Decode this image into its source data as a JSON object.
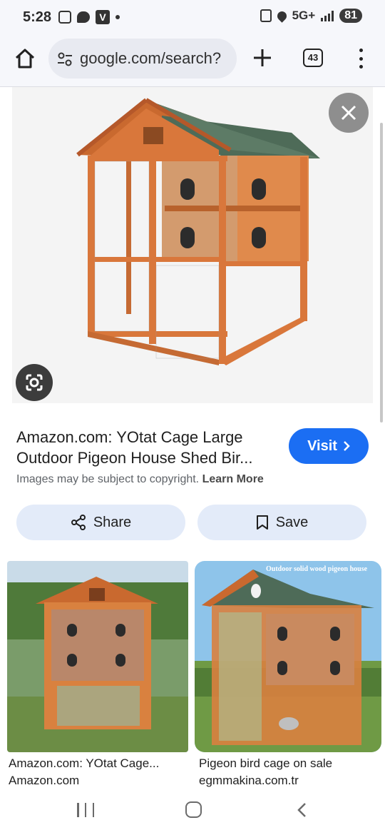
{
  "status_bar": {
    "time": "5:28",
    "network": "5G+",
    "battery": "81",
    "v_badge": "V"
  },
  "browser": {
    "url": "google.com/search?",
    "tab_count": "43"
  },
  "result": {
    "title_line1": "Amazon.com: YOtat Cage Large",
    "title_line2": "Outdoor Pigeon House Shed Bir...",
    "visit_label": "Visit",
    "copyright_text": "Images may be subject to copyright.",
    "learn_more": "Learn More",
    "share_label": "Share",
    "save_label": "Save"
  },
  "related": [
    {
      "title": "Amazon.com: YOtat Cage...",
      "source": "Amazon.com"
    },
    {
      "title": "Pigeon bird cage on sale",
      "source": "egmmakina.com.tr",
      "overlay_text": "Outdoor solid wood pigeon house"
    }
  ],
  "colors": {
    "accent": "#1b6ef3",
    "wood": "#d9773b",
    "roof": "#4e6b58"
  }
}
